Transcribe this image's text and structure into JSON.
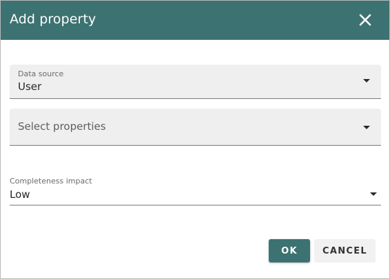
{
  "dialog": {
    "title": "Add property",
    "close_icon": "close-icon"
  },
  "fields": {
    "data_source": {
      "label": "Data source",
      "value": "User"
    },
    "properties": {
      "placeholder": "Select properties"
    },
    "completeness": {
      "label": "Completeness impact",
      "value": "Low"
    }
  },
  "actions": {
    "ok_label": "OK",
    "cancel_label": "CANCEL"
  },
  "colors": {
    "accent": "#3d7272",
    "field_bg": "#efefef"
  }
}
